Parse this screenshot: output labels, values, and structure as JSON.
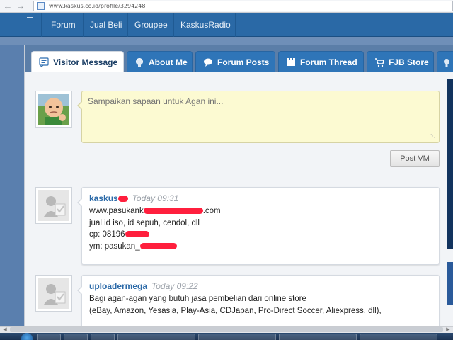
{
  "browser": {
    "url": "www.kaskus.co.id/profile/3294248"
  },
  "topnav": {
    "items": [
      "Forum",
      "Jual Beli",
      "Groupee",
      "KaskusRadio"
    ]
  },
  "tabs": [
    {
      "label": "Visitor Message",
      "icon": "speech-note-icon",
      "active": true
    },
    {
      "label": "About Me",
      "icon": "person-bulb-icon",
      "active": false
    },
    {
      "label": "Forum Posts",
      "icon": "chat-bubble-icon",
      "active": false
    },
    {
      "label": "Forum Thread",
      "icon": "film-strip-icon",
      "active": false
    },
    {
      "label": "FJB Store",
      "icon": "cart-icon",
      "active": false
    }
  ],
  "composer": {
    "placeholder": "Sampaikan sapaan untuk Agan ini...",
    "submit_label": "Post VM"
  },
  "messages": [
    {
      "user": "kaskus",
      "time": "Today 09:31",
      "lines": [
        {
          "text": "www.pasukank",
          "after": ".com"
        },
        {
          "text": "jual id iso, id sepuh, cendol, dll"
        },
        {
          "text": "cp: 08196"
        },
        {
          "text": "ym: pasukan_"
        }
      ]
    },
    {
      "user": "uploadermega",
      "time": "Today 09:22",
      "lines": [
        {
          "text": "Bagi agan-agan yang butuh jasa pembelian dari online store"
        },
        {
          "text": "(eBay, Amazon, Yesasia, Play-Asia, CDJapan, Pro-Direct Soccer, Aliexpress, dll),"
        }
      ]
    }
  ],
  "colors": {
    "nav": "#2a69a6",
    "tab": "#2f75b8",
    "username": "#2c6aa8",
    "composer_bg": "#fcfad2",
    "redaction": "#ff1f3d"
  }
}
